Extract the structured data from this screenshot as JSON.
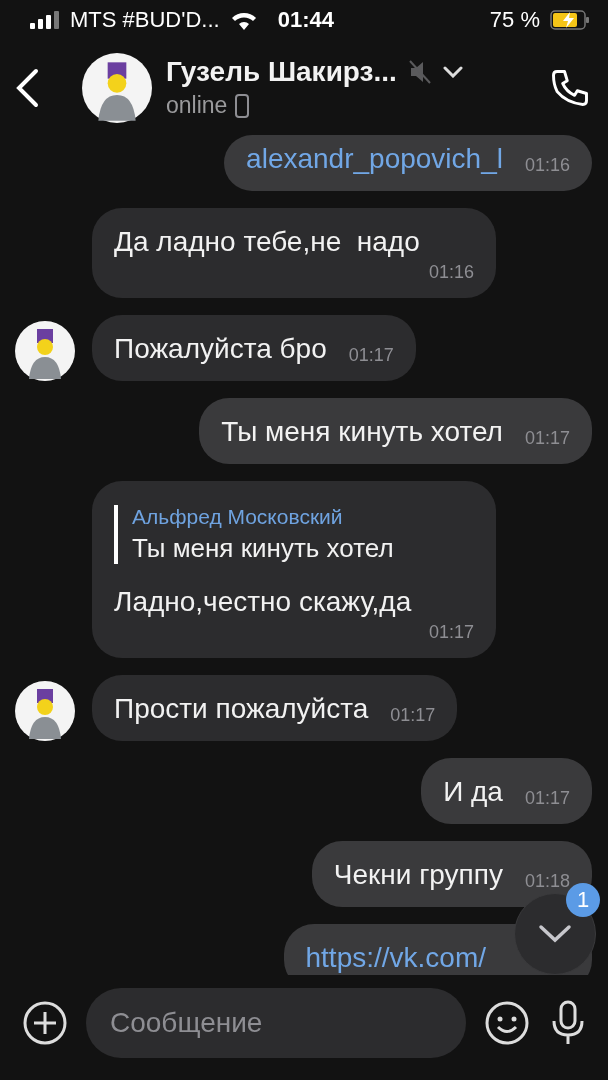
{
  "status_bar": {
    "carrier": "MTS #BUD'D...",
    "time": "01:44",
    "battery": "75 %"
  },
  "header": {
    "title": "Гузель Шакирз...",
    "muted": true,
    "status": "online"
  },
  "messages": [
    {
      "outgoing": true,
      "kind": "link",
      "text": "alexandr_popovich_l",
      "time": "01:16",
      "avatar": false
    },
    {
      "outgoing": false,
      "kind": "text",
      "text": "Да ладно тебе,не  надо",
      "time": "01:16",
      "avatar": false
    },
    {
      "outgoing": false,
      "kind": "text",
      "text": "Пожалуйста бро",
      "time": "01:17",
      "avatar": true
    },
    {
      "outgoing": true,
      "kind": "text",
      "text": "Ты меня кинуть хотел",
      "time": "01:17",
      "avatar": false
    },
    {
      "outgoing": false,
      "kind": "text",
      "text": "Ладно,честно скажу,да",
      "time": "01:17",
      "avatar": false,
      "reply": {
        "author": "Альфред Московский",
        "text": "Ты меня кинуть хотел"
      }
    },
    {
      "outgoing": false,
      "kind": "text",
      "text": "Прости пожалуйста",
      "time": "01:17",
      "avatar": true
    },
    {
      "outgoing": true,
      "kind": "text",
      "text": "И да",
      "time": "01:17",
      "avatar": false
    },
    {
      "outgoing": true,
      "kind": "text",
      "text": "Чекни группу",
      "time": "01:18",
      "avatar": false
    },
    {
      "outgoing": true,
      "kind": "link",
      "text": "https://vk.com/",
      "avatar": false
    }
  ],
  "scroll_down": {
    "badge": "1"
  },
  "composer": {
    "placeholder": "Сообщение"
  }
}
